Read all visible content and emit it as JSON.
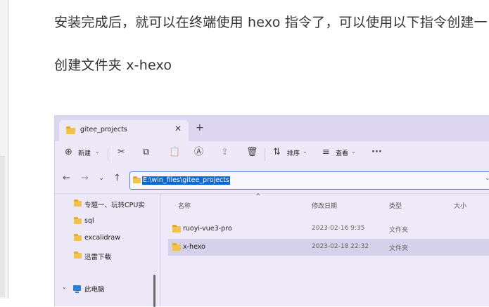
{
  "article": {
    "line1": "安装完成后，就可以在终端使用 hexo 指令了，可以使用以下指令创建一",
    "line2": "创建文件夹 x-hexo"
  },
  "explorer": {
    "tab": {
      "title": "gitee_projects",
      "close": "✕",
      "add": "+"
    },
    "toolbar": {
      "new_icon": "⊕",
      "new_label": "新建",
      "caret": "⌄",
      "cut_icon": "✂",
      "copy_icon": "⧉",
      "paste_icon": "📋",
      "rename_icon": "Ⓐ",
      "share_icon": "⇪",
      "delete_icon": "🗑",
      "sort_icon": "⇅",
      "sort_label": "排序",
      "view_icon": "≡",
      "view_label": "查看",
      "more_icon": "···"
    },
    "nav": {
      "back": "←",
      "forward": "→",
      "recent": "⌄",
      "up": "↑"
    },
    "address": {
      "path": "E:\\win_files\\gitee_projects",
      "caret": "⌄"
    },
    "sidebar": {
      "items": [
        {
          "label": "专题一、玩转CPU实",
          "pin": "📌"
        },
        {
          "label": "sql"
        },
        {
          "label": "excalidraw"
        },
        {
          "label": "迅雷下载"
        }
      ],
      "pc_caret": "⌄",
      "pc_label": "此电脑"
    },
    "columns": {
      "name": "名称",
      "modified": "修改日期",
      "type": "类型",
      "size": "大小",
      "sort_arrow": "^"
    },
    "files": [
      {
        "name": "ruoyi-vue3-pro",
        "modified": "2023-02-16 9:35",
        "type": "文件夹",
        "selected": false
      },
      {
        "name": "x-hexo",
        "modified": "2023-02-18 22:32",
        "type": "文件夹",
        "selected": true
      }
    ]
  }
}
